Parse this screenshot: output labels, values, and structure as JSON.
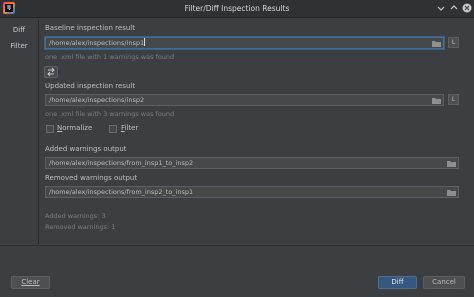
{
  "window": {
    "title": "Filter/Diff Inspection Results",
    "app_icon_text": "IJ"
  },
  "sidebar": {
    "items": [
      {
        "label": "Diff"
      },
      {
        "label": "Filter"
      }
    ]
  },
  "diff": {
    "baseline": {
      "label": "Baseline inspection result",
      "value": "/home/alex/inspections/insp1",
      "hint": "one .xml file with 1 warnings was found",
      "load_button": "L"
    },
    "updated": {
      "label": "Updated inspection result",
      "value": "/home/alex/inspections/insp2",
      "hint": "one .xml file with 3 warnings was found",
      "load_button": "L"
    },
    "options": {
      "normalize_label": "Normalize",
      "filter_label": "Filter",
      "normalize_checked": false,
      "filter_checked": false
    },
    "added_output": {
      "label": "Added warnings output",
      "value": "/home/alex/inspections/from_insp1_to_insp2"
    },
    "removed_output": {
      "label": "Removed warnings output",
      "value": "/home/alex/inspections/from_insp2_to_insp1"
    },
    "summary": {
      "added": "Added warnings: 3",
      "removed": "Removed warnings: 1"
    }
  },
  "footer": {
    "clear_label": "Clear",
    "diff_label": "Diff",
    "cancel_label": "Cancel"
  },
  "icons": {
    "swap": "swap-arrows-icon",
    "folder": "folder-icon",
    "minimize": "minimize-icon",
    "maximize": "maximize-icon",
    "close": "close-icon"
  }
}
